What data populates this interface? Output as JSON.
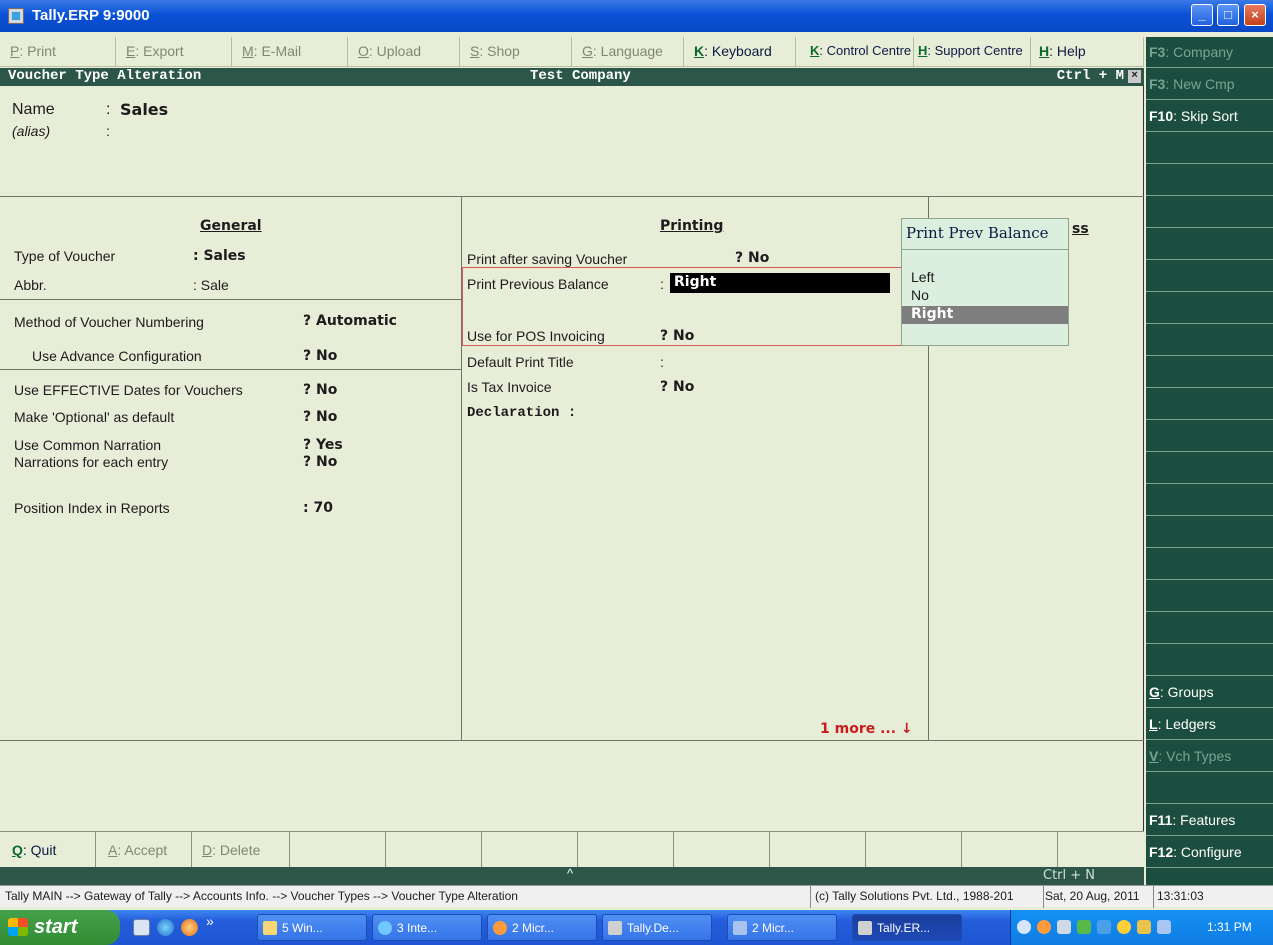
{
  "window": {
    "title": "Tally.ERP 9:9000",
    "min": "_",
    "max": "□",
    "close": "×"
  },
  "topbar": [
    {
      "key": "P",
      "label": ": Print",
      "on": false
    },
    {
      "key": "E",
      "label": ": Export",
      "on": false
    },
    {
      "key": "M",
      "label": ": E-Mail",
      "on": false
    },
    {
      "key": "O",
      "label": ": Upload",
      "on": false
    },
    {
      "key": "S",
      "label": ": Shop",
      "on": false
    },
    {
      "key": "G",
      "label": ": Language",
      "on": false
    },
    {
      "key": "K",
      "label": ": Keyboard",
      "on": true
    },
    {
      "key": "K",
      "label": ": Control Centre",
      "on": true
    },
    {
      "key": "H",
      "label": ": Support Centre",
      "on": true
    },
    {
      "key": "H",
      "label": ": Help",
      "on": true
    }
  ],
  "header": {
    "screen": "Voucher Type Alteration",
    "company": "Test Company",
    "shortcut": "Ctrl + M",
    "close": "×"
  },
  "name_section": {
    "name_label": "Name",
    "name_sep": ":",
    "name_value": "Sales",
    "alias_label": "(alias)",
    "alias_sep": ":"
  },
  "general": {
    "title": "General",
    "type_label": "Type of Voucher",
    "type_value": ": Sales",
    "abbr_label": "Abbr.",
    "abbr_value": ": Sale",
    "method_label": "Method of Voucher Numbering",
    "method_value": "? Automatic",
    "advance_label": "Use Advance Configuration",
    "advance_value": "? No",
    "effective_label": "Use EFFECTIVE Dates for Vouchers",
    "effective_value": "? No",
    "optional_label": "Make 'Optional' as default",
    "optional_value": "? No",
    "common_label": "Use Common Narration",
    "common_value": "? Yes",
    "each_label": "Narrations for each entry",
    "each_value": "? No",
    "position_label": "Position Index in Reports",
    "position_value": ": 70"
  },
  "printing": {
    "title": "Printing",
    "after_label": "Print after saving Voucher",
    "after_value": "? No",
    "prevbal_label": "Print Previous Balance",
    "prevbal_sep": ":",
    "prevbal_value": "Right",
    "pos_label": "Use for POS Invoicing",
    "pos_value": "? No",
    "title_label": "Default Print Title",
    "title_sep": ":",
    "tax_label": "Is Tax Invoice",
    "tax_value": "? No",
    "declaration_label": "Declaration  :",
    "more": "1 more ... ↓"
  },
  "popup": {
    "title": "Print Prev Balance",
    "behind_fragment": "ss",
    "options": [
      "Left",
      "No",
      "Right"
    ],
    "selected": "Right"
  },
  "sidebar": [
    {
      "key": "F3",
      "label": ": Company",
      "dim": true
    },
    {
      "key": "F3",
      "label": ": New Cmp",
      "dim": true
    },
    {
      "key": "F10",
      "label": ": Skip Sort",
      "dim": false
    },
    {
      "key": "G",
      "label": ": Groups",
      "dim": false
    },
    {
      "key": "L",
      "label": ": Ledgers",
      "dim": false
    },
    {
      "key": "V",
      "label": ": Vch Types",
      "dim": true
    },
    {
      "key": "F11",
      "label": ": Features",
      "dim": false
    },
    {
      "key": "F12",
      "label": ": Configure",
      "dim": false
    }
  ],
  "bottombar": [
    {
      "key": "Q",
      "label": ": Quit",
      "on": true
    },
    {
      "key": "A",
      "label": ": Accept",
      "on": false
    },
    {
      "key": "D",
      "label": ": Delete",
      "on": false
    }
  ],
  "bottom_band": {
    "caret": "^",
    "shortcut": "Ctrl + N"
  },
  "status": {
    "path": "Tally MAIN --> Gateway of Tally --> Accounts Info. --> Voucher Types --> Voucher Type Alteration",
    "copyright": "(c) Tally Solutions Pvt. Ltd., 1988-201",
    "date": "Sat, 20 Aug, 2011",
    "time": "13:31:03"
  },
  "taskbar": {
    "start": "start",
    "overflow": "»",
    "tasks": [
      "5 Win...",
      "3 Inte...",
      "2 Micr...",
      "Tally.De...",
      "2 Micr...",
      "Tally.ER..."
    ],
    "clock": "1:31 PM"
  },
  "colors": {
    "panel": "#e8edd8",
    "band": "#2b5648",
    "sidebar": "#1c4e3f",
    "title_blue": "#0a52d8"
  }
}
